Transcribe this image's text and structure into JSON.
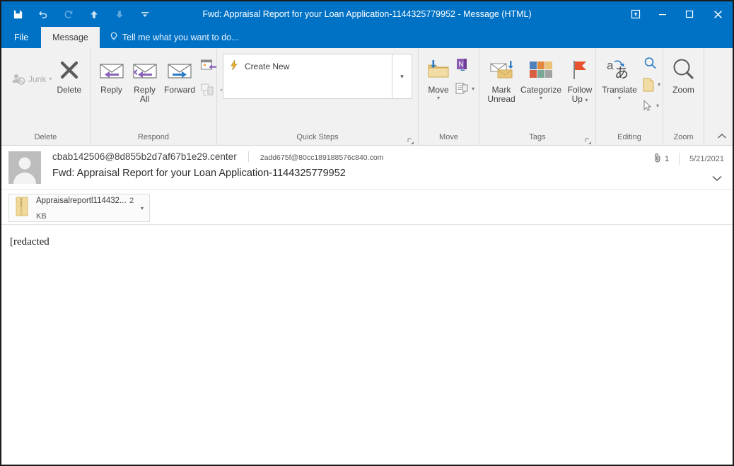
{
  "window": {
    "title": "Fwd: Appraisal Report for your Loan Application-1144325779952 - Message (HTML)",
    "accent_color": "#0072c6",
    "ribbon_bg": "#f1f1f1"
  },
  "quick_access": {
    "save": "save-icon",
    "undo": "undo-icon",
    "redo": "redo-icon",
    "previous": "up-arrow-icon",
    "next": "down-arrow-icon",
    "customize": "customize-qat-icon"
  },
  "window_controls": {
    "restore_ribbon": "touch-mode-icon",
    "minimize": "minimize-icon",
    "maximize": "maximize-icon",
    "close": "close-icon"
  },
  "tabs": {
    "file": "File",
    "message": "Message",
    "tell_me": "Tell me what you want to do..."
  },
  "ribbon": {
    "groups": [
      {
        "name": "Delete",
        "label": "Delete",
        "buttons": [
          {
            "label": "Junk",
            "icon": "junk-icon",
            "disabled": true,
            "has_caret": true
          },
          {
            "label": "Delete",
            "icon": "delete-x-icon",
            "disabled": false,
            "has_caret": false
          }
        ]
      },
      {
        "name": "Respond",
        "label": "Respond",
        "buttons": [
          {
            "label": "Reply",
            "icon": "reply-icon"
          },
          {
            "label": "Reply All",
            "icon": "reply-all-icon"
          },
          {
            "label": "Forward",
            "icon": "forward-icon"
          },
          {
            "label": "Meeting",
            "icon": "meeting-icon"
          },
          {
            "label": "More",
            "icon": "im-icon"
          }
        ]
      },
      {
        "name": "Quick Steps",
        "label": "Quick Steps",
        "gallery_item": "Create New",
        "has_launcher": true
      },
      {
        "name": "Move",
        "label": "Move",
        "buttons": [
          {
            "label": "Move",
            "icon": "move-folder-icon",
            "has_caret": true
          },
          {
            "label": "OneNote",
            "icon": "onenote-icon"
          },
          {
            "label": "Rules",
            "icon": "rules-icon",
            "has_caret": true
          }
        ]
      },
      {
        "name": "Tags",
        "label": "Tags",
        "has_launcher": true,
        "buttons": [
          {
            "label": "Mark Unread",
            "icon": "mark-unread-icon"
          },
          {
            "label": "Categorize",
            "icon": "categorize-icon",
            "has_caret": true
          },
          {
            "label": "Follow Up",
            "icon": "follow-up-flag-icon",
            "has_caret": true
          }
        ]
      },
      {
        "name": "Editing",
        "label": "Editing",
        "buttons": [
          {
            "label": "Translate",
            "icon": "translate-icon",
            "has_caret": true
          },
          {
            "label": "Find",
            "icon": "find-icon"
          },
          {
            "label": "Select",
            "icon": "select-pointer-icon",
            "has_caret": true
          }
        ]
      },
      {
        "name": "Zoom",
        "label": "Zoom",
        "buttons": [
          {
            "label": "Zoom",
            "icon": "zoom-magnifier-icon"
          }
        ]
      }
    ],
    "collapse_label": "collapse-ribbon-icon"
  },
  "message": {
    "from": "cbab142506@8d855b2d7af67b1e29.center",
    "to": "2add675f@80cc189188576c840.com",
    "subject": "Fwd: Appraisal Report for your Loan Application-1144325779952",
    "attachment_count": "1",
    "date": "5/21/2021",
    "body": "[redacted"
  },
  "attachment": {
    "name": "Appraisalreportl114432...",
    "size": "2 KB",
    "icon": "zip-file-icon"
  }
}
